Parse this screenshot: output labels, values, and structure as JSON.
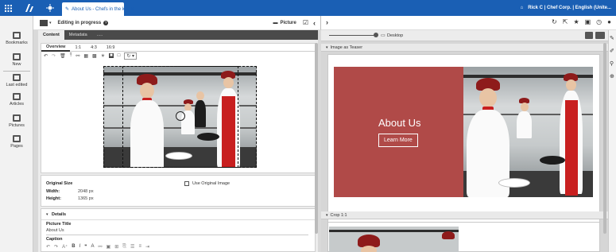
{
  "topbar": {
    "tab_title": "About Us - Chefs in the k...",
    "user_label": "Rick C | Chef Corp. | English (Unite..."
  },
  "sidebar": {
    "items": [
      {
        "label": "Bookmarks",
        "icon": "bookmark-icon"
      },
      {
        "label": "New",
        "icon": "new-document-icon"
      },
      {
        "label": "Last edited",
        "icon": "clock-icon"
      },
      {
        "label": "Articles",
        "icon": "folder-icon"
      },
      {
        "label": "Pictures",
        "icon": "folder-icon"
      },
      {
        "label": "Pages",
        "icon": "folder-icon"
      }
    ]
  },
  "editor_toolbar": {
    "status_label": "Editing in progress",
    "doc_type_label": "Picture"
  },
  "editor_tabs": {
    "content": "Content",
    "metadata": "Metadata",
    "more": "....."
  },
  "crop_tabs": [
    "Overview",
    "1:1",
    "4:3",
    "16:9"
  ],
  "image_info": {
    "original_size_label": "Original Size",
    "width_label": "Width:",
    "width_value": "2048 px",
    "height_label": "Height:",
    "height_value": "1365 px",
    "use_original_label": "Use Original Image"
  },
  "details": {
    "section_label": "Details",
    "picture_title_label": "Picture Title",
    "picture_title_value": "About Us",
    "caption_label": "Caption"
  },
  "preview": {
    "device_label": "Desktop",
    "section1_label": "Image as Teaser",
    "section2_label": "Crop 1:1",
    "teaser_heading": "About Us",
    "teaser_button": "Learn More"
  },
  "colors": {
    "topbar": "#1a5fb4",
    "teaser_panel": "#b04a48",
    "chef_red": "#c81f1f"
  }
}
